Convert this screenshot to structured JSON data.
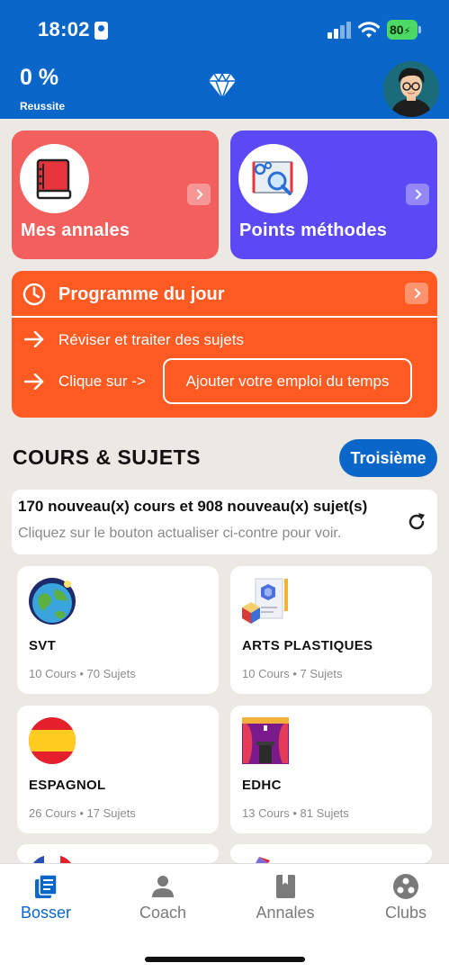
{
  "status_bar": {
    "time": "18:02",
    "battery": "80"
  },
  "header": {
    "success_rate": "0 %",
    "success_label": "Reussite"
  },
  "cards": {
    "annales": "Mes annales",
    "methodes": "Points méthodes"
  },
  "programme": {
    "title": "Programme du jour",
    "line1": "Réviser et traiter des sujets",
    "line2": "Clique sur ->",
    "add_button": "Ajouter votre emploi du temps"
  },
  "section": {
    "title": "COURS & SUJETS",
    "level": "Troisième"
  },
  "news": {
    "title": "170 nouveau(x) cours et 908 nouveau(x) sujet(s)",
    "subtitle": "Cliquez sur le bouton actualiser ci-contre pour voir."
  },
  "subjects": [
    {
      "name": "SVT",
      "meta": "10 Cours • 70 Sujets",
      "icon": "earth-icon"
    },
    {
      "name": "ARTS PLASTIQUES",
      "meta": "10 Cours • 7 Sujets",
      "icon": "art-icon"
    },
    {
      "name": "ESPAGNOL",
      "meta": "26 Cours • 17 Sujets",
      "icon": "spain-flag-icon"
    },
    {
      "name": "EDHC",
      "meta": "13 Cours • 81 Sujets",
      "icon": "podium-icon"
    }
  ],
  "nav": [
    {
      "label": "Bosser",
      "icon": "book-icon",
      "active": true
    },
    {
      "label": "Coach",
      "icon": "person-icon",
      "active": false
    },
    {
      "label": "Annales",
      "icon": "bookmark-book-icon",
      "active": false
    },
    {
      "label": "Clubs",
      "icon": "group-icon",
      "active": false
    }
  ],
  "colors": {
    "primary": "#0a66c9",
    "annales_card": "#f25f5c",
    "methodes_card": "#5b49f5",
    "programme": "#fe5a22",
    "background": "#ece8e3"
  }
}
